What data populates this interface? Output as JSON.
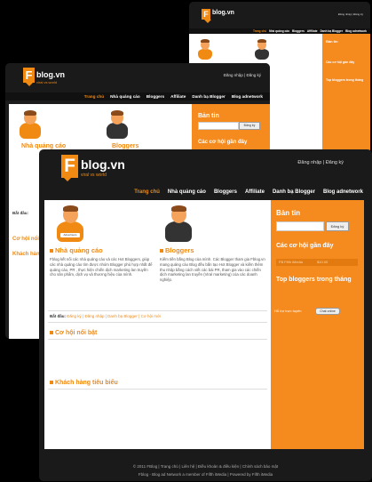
{
  "site": {
    "logo_letter": "F",
    "logo_text": "blog.vn",
    "tagline": "viral vs world",
    "login_link": "Đăng nhập | Đăng ký",
    "accent_color": "#f08a12"
  },
  "nav": {
    "home": "Trang chủ",
    "advertisers": "Nhà quảng cáo",
    "bloggers": "Bloggers",
    "affiliate": "Affiliate",
    "directory": "Danh bạ Blogger",
    "network": "Blog adnetwork"
  },
  "main": {
    "advertiser_badge": "Advertisers",
    "advertiser_title": "Nhà quảng cáo",
    "advertiser_desc": "Fblog kết nối các nhà quảng cáo và các Hot Bloggers, giúp các nhà quảng cáo tìm được nhóm Blogger phù hợp nhất để quảng cáo, PR , thực hiện chiến dịch marketing lan truyền cho sản phẩm, dịch vụ và thương hiệu của mình.",
    "blogger_title": "Bloggers",
    "blogger_desc": "Kiếm tiền bằng Blog của mình. Các Blogger tham gia Fblog.vn mang quảng cáo Blog đều bắn tạo Hot Blogger và kiếm thêm thu nhập bằng cách viết các bài PR, tham gia vào các chiến dịch marketing lan truyền (Viral marketing) của các doanh nghiệp.",
    "for_label": "Bắt đầu:",
    "for_links": "Đăng ký | Đăng nhập | Danh bạ Blogger | Cơ hội mới",
    "opportunities_title": "Cơ hội nổi bật",
    "customers_title": "Khách hàng tiêu biểu"
  },
  "sidebar": {
    "newsletter_title": "Bản tin",
    "register_button": "Đăng ký",
    "recent_title": "Các cơ hội gần đây",
    "recent_item": "FB Fifth iMedia",
    "recent_price": "$10.00",
    "top_title": "Top bloggers trong tháng",
    "status_label": "Hỗ trợ trực tuyến",
    "status_button": "Chat online"
  },
  "footer": {
    "line1": "© 2011 FBlog  |  Trang chủ  |  Liên hệ  |  Điều khoản & điều kiện  |  Chính sách bảo mật",
    "line2": "Fblog - Blog ad Network a member of Fifth iMedia | Powered by Fifth iMedia"
  }
}
